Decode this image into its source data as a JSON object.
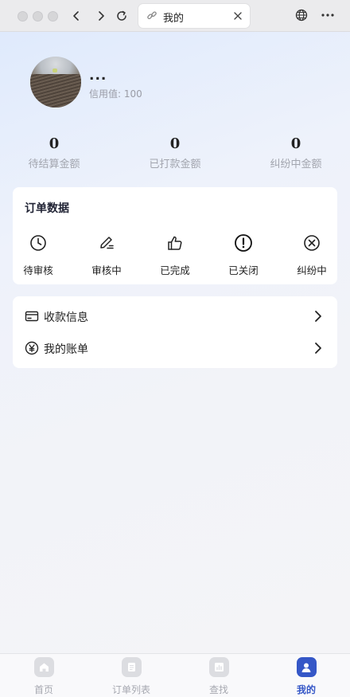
{
  "browser": {
    "tab_title": "我的"
  },
  "profile": {
    "username": "...",
    "credit": "信用值: 100"
  },
  "stats": [
    {
      "value": "0",
      "label": "待结算金额"
    },
    {
      "value": "0",
      "label": "已打款金额"
    },
    {
      "value": "0",
      "label": "纠纷中金额"
    }
  ],
  "orders": {
    "title": "订单数据",
    "items": [
      {
        "label": "待审核",
        "icon": "clock-icon"
      },
      {
        "label": "审核中",
        "icon": "edit-icon"
      },
      {
        "label": "已完成",
        "icon": "thumbs-up-icon"
      },
      {
        "label": "已关闭",
        "icon": "exclamation-circle-icon"
      },
      {
        "label": "纠纷中",
        "icon": "x-circle-icon"
      }
    ]
  },
  "menu": {
    "items": [
      {
        "label": "收款信息",
        "icon": "card-icon"
      },
      {
        "label": "我的账单",
        "icon": "yen-circle-icon"
      }
    ]
  },
  "tabbar": {
    "items": [
      {
        "label": "首页",
        "icon": "home-icon"
      },
      {
        "label": "订单列表",
        "icon": "list-icon"
      },
      {
        "label": "查找",
        "icon": "chart-icon"
      },
      {
        "label": "我的",
        "icon": "user-icon"
      }
    ],
    "active_index": 3,
    "active_color": "#3557c7"
  }
}
